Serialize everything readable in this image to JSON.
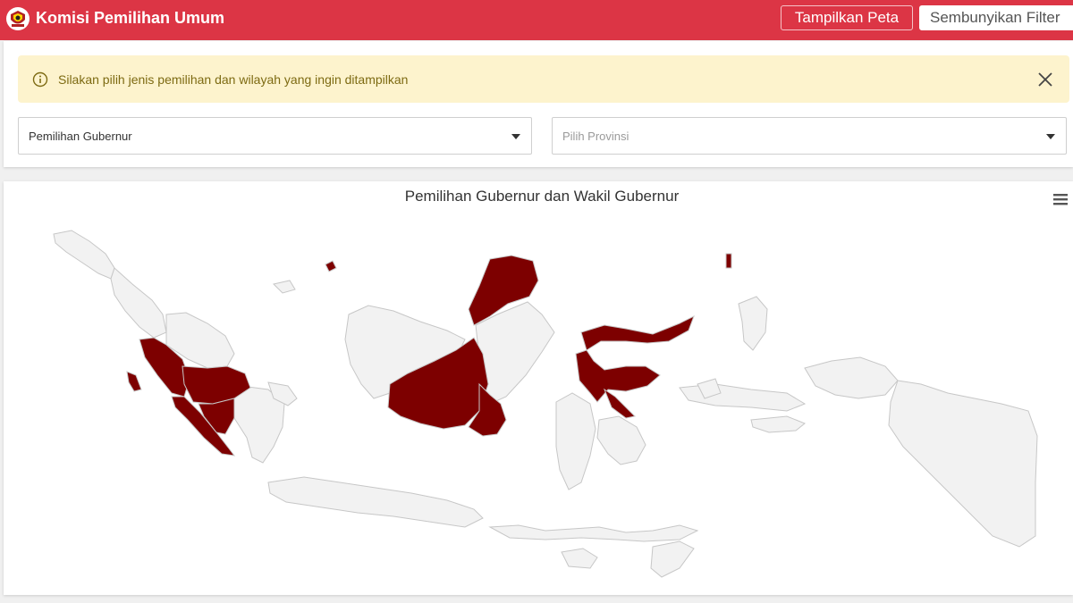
{
  "header": {
    "brand": "Komisi Pemilihan Umum",
    "logo_icon": "kpu-logo-icon",
    "show_map_label": "Tampilkan Peta",
    "hide_filter_label": "Sembunyikan Filter",
    "bar_color": "#dc3545"
  },
  "alert": {
    "icon": "info-circle-icon",
    "text": "Silakan pilih jenis pemilihan dan wilayah yang ingin ditampilkan",
    "close_icon": "close-icon",
    "bg_color": "#fdf3cd"
  },
  "filters": {
    "election_type": {
      "selected": "Pemilihan Gubernur"
    },
    "province": {
      "placeholder": "Pilih Provinsi"
    }
  },
  "map": {
    "title": "Pemilihan Gubernur dan Wakil Gubernur",
    "menu_icon": "hamburger-menu-icon",
    "highlight_color": "#7d0000",
    "base_color": "#f2f2f2"
  }
}
